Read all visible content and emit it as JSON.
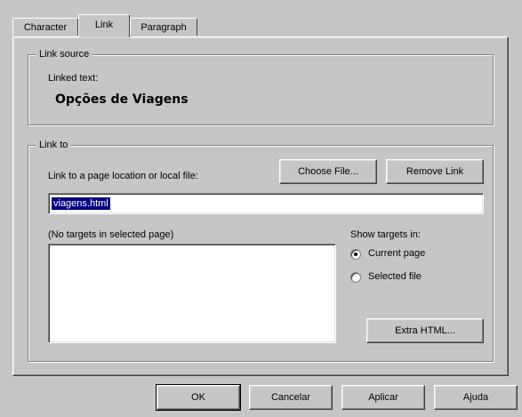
{
  "tabs": [
    {
      "label": "Character"
    },
    {
      "label": "Link"
    },
    {
      "label": "Paragraph"
    }
  ],
  "link_source": {
    "group_label": "Link source",
    "linked_text_label": "Linked text:",
    "linked_text_value": "Opções de Viagens"
  },
  "link_to": {
    "group_label": "Link to",
    "field_label": "Link to a page location or local file:",
    "choose_file_button": "Choose File...",
    "remove_link_button": "Remove Link",
    "url_value": "viagens.html",
    "targets_label": "(No targets in selected page)",
    "show_targets_label": "Show targets in:",
    "radio_current_page": "Current page",
    "radio_selected_file": "Selected file",
    "selected_radio": "current_page",
    "extra_html_button": "Extra HTML..."
  },
  "footer": {
    "ok_button": "OK",
    "cancel_button": "Cancelar",
    "apply_button": "Aplicar",
    "help_button": "Ajuda"
  }
}
